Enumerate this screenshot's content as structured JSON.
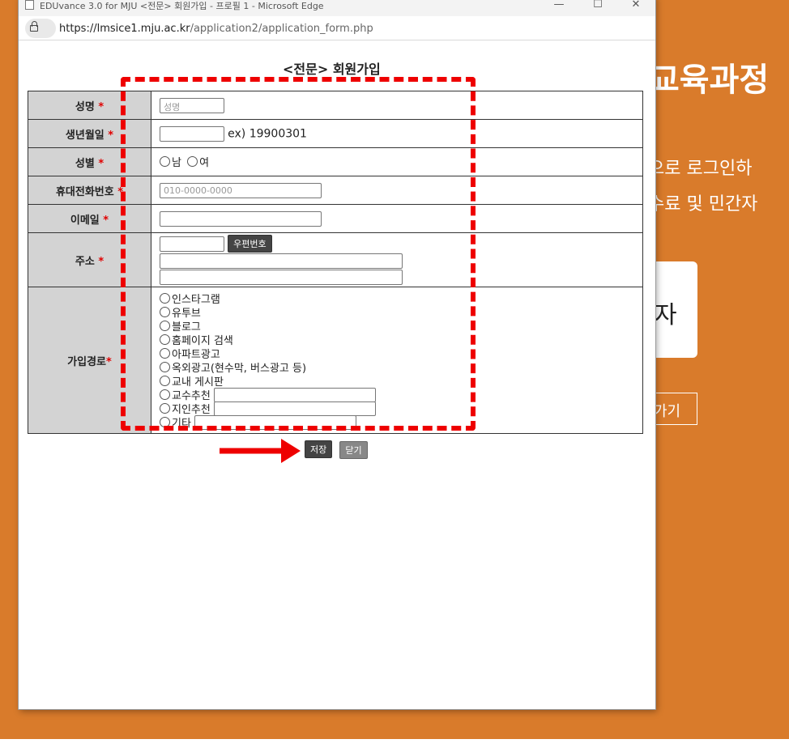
{
  "background_page": {
    "heading": "교육과정",
    "line1": "으로 로그인하",
    "line2": "수료 및 민간자",
    "card_text": "자",
    "button_text": "가기"
  },
  "window": {
    "title": "EDUvance 3.0 for MJU <전문> 회원가입 - 프로필 1 - Microsoft Edge",
    "url_host": "https://lmsice1.mju.ac.kr",
    "url_path": "/application2/application_form.php",
    "controls": {
      "minimize": "—",
      "maximize": "☐",
      "close": "✕"
    }
  },
  "form": {
    "title": "<전문> 회원가입",
    "required_mark": "*",
    "rows": {
      "name": {
        "label": "성명",
        "placeholder": "성명"
      },
      "birthdate": {
        "label": "생년월일",
        "hint": "ex) 19900301"
      },
      "gender": {
        "label": "성별",
        "options": [
          "남",
          "여"
        ]
      },
      "mobile": {
        "label": "휴대전화번호",
        "placeholder": "010-0000-0000"
      },
      "email": {
        "label": "이메일"
      },
      "address": {
        "label": "주소",
        "postcode_button": "우편번호"
      },
      "source": {
        "label": "가입경로",
        "options": [
          "인스타그램",
          "유투브",
          "블로그",
          "홈페이지 검색",
          "아파트광고",
          "옥외광고(현수막, 버스광고 등)",
          "교내 게시판",
          "교수추천",
          "지인추천",
          "기타"
        ]
      }
    },
    "save_button": "저장",
    "close_button": "닫기"
  },
  "colors": {
    "background": "#d97b2b",
    "annotation": "#ee0000",
    "label_cell": "#d3d3d3"
  }
}
